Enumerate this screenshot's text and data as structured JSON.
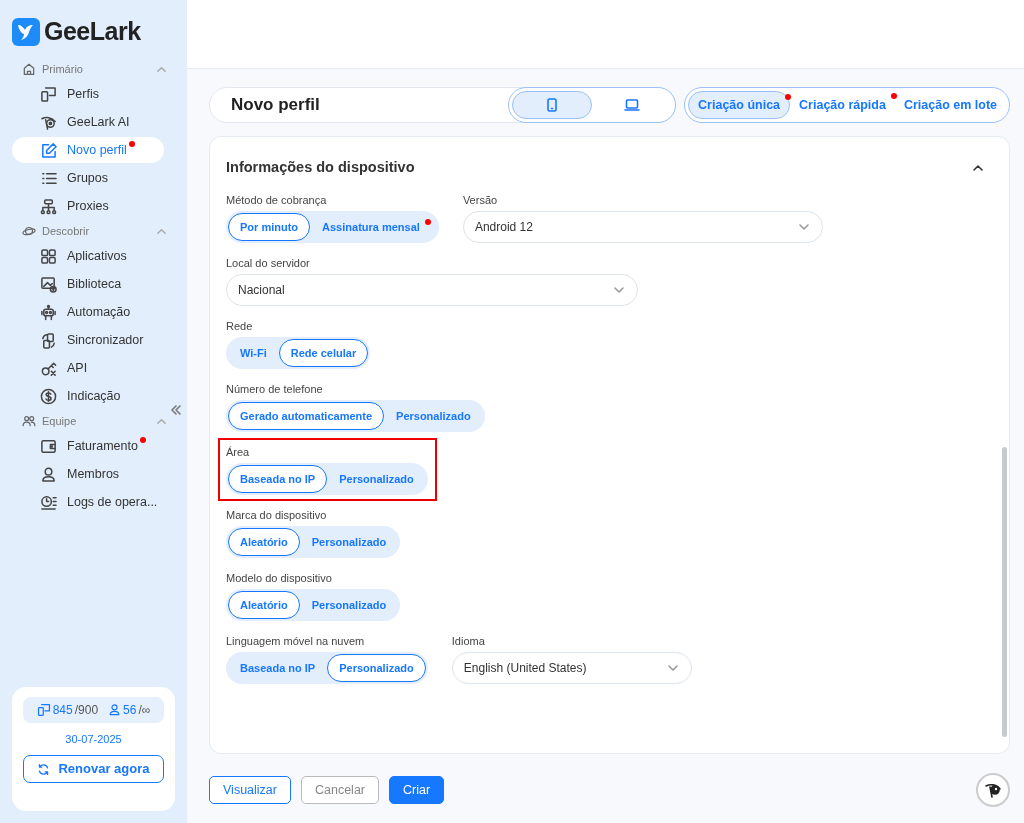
{
  "sidebar": {
    "logo": "GeeLark",
    "groups": [
      {
        "title": "Primário",
        "expanded": true,
        "items": [
          {
            "label": "Perfis",
            "selected": false,
            "dot": false
          },
          {
            "label": "GeeLark AI",
            "selected": false,
            "dot": false
          },
          {
            "label": "Novo perfil",
            "selected": true,
            "dot": true
          },
          {
            "label": "Grupos",
            "selected": false,
            "dot": false
          },
          {
            "label": "Proxies",
            "selected": false,
            "dot": false
          }
        ]
      },
      {
        "title": "Descobrir",
        "expanded": true,
        "items": [
          {
            "label": "Aplicativos",
            "selected": false,
            "dot": false
          },
          {
            "label": "Biblioteca",
            "selected": false,
            "dot": false
          },
          {
            "label": "Automação",
            "selected": false,
            "dot": false
          },
          {
            "label": "Sincronizador",
            "selected": false,
            "dot": false
          },
          {
            "label": "API",
            "selected": false,
            "dot": false
          },
          {
            "label": "Indicação",
            "selected": false,
            "dot": false
          }
        ]
      },
      {
        "title": "Equipe",
        "expanded": true,
        "items": [
          {
            "label": "Faturamento",
            "selected": false,
            "dot": true
          },
          {
            "label": "Membros",
            "selected": false,
            "dot": false
          },
          {
            "label": "Logs de opera...",
            "selected": false,
            "dot": false
          }
        ]
      }
    ],
    "plan": {
      "profiles_used": "845",
      "profiles_total": "/900",
      "members_used": "56",
      "members_total": "/∞",
      "date": "30-07-2025",
      "renew_button": "Renovar agora"
    }
  },
  "header": {
    "title": "Novo perfil",
    "device_tabs": [
      {
        "selected": true
      },
      {
        "selected": false
      }
    ],
    "creation_tabs": [
      {
        "label": "Criação única",
        "selected": true,
        "dot": true
      },
      {
        "label": "Criação rápida",
        "selected": false,
        "dot": true
      },
      {
        "label": "Criação em lote",
        "selected": false,
        "dot": false
      }
    ]
  },
  "form": {
    "title": "Informações do dispositivo",
    "expanded": true,
    "rows": [
      [
        {
          "kind": "segmented",
          "label": "Método de cobrança",
          "highlighted": false,
          "options": [
            {
              "label": "Por minuto",
              "selected": true,
              "dot": false
            },
            {
              "label": "Assinatura mensal",
              "selected": false,
              "dot": true
            }
          ]
        },
        {
          "kind": "select",
          "label": "Versão",
          "highlighted": false,
          "value": "Android 12"
        }
      ],
      [
        {
          "kind": "select",
          "label": "Local do servidor",
          "highlighted": false,
          "value": "Nacional"
        }
      ],
      [
        {
          "kind": "segmented",
          "label": "Rede",
          "highlighted": false,
          "options": [
            {
              "label": "Wi-Fi",
              "selected": false,
              "dot": false
            },
            {
              "label": "Rede celular",
              "selected": true,
              "dot": false
            }
          ]
        }
      ],
      [
        {
          "kind": "segmented",
          "label": "Número de telefone",
          "highlighted": false,
          "options": [
            {
              "label": "Gerado automaticamente",
              "selected": true,
              "dot": false
            },
            {
              "label": "Personalizado",
              "selected": false,
              "dot": false
            }
          ]
        }
      ],
      [
        {
          "kind": "segmented",
          "label": "Área",
          "highlighted": true,
          "options": [
            {
              "label": "Baseada no IP",
              "selected": true,
              "dot": false
            },
            {
              "label": "Personalizado",
              "selected": false,
              "dot": false
            }
          ]
        }
      ],
      [
        {
          "kind": "segmented",
          "label": "Marca do dispositivo",
          "highlighted": false,
          "options": [
            {
              "label": "Aleatório",
              "selected": true,
              "dot": false
            },
            {
              "label": "Personalizado",
              "selected": false,
              "dot": false
            }
          ]
        }
      ],
      [
        {
          "kind": "segmented",
          "label": "Modelo do dispositivo",
          "highlighted": false,
          "options": [
            {
              "label": "Aleatório",
              "selected": true,
              "dot": false
            },
            {
              "label": "Personalizado",
              "selected": false,
              "dot": false
            }
          ]
        }
      ],
      [
        {
          "kind": "segmented",
          "label": "Linguagem móvel na nuvem",
          "highlighted": false,
          "options": [
            {
              "label": "Baseada no IP",
              "selected": false,
              "dot": false
            },
            {
              "label": "Personalizado",
              "selected": true,
              "dot": false
            }
          ]
        },
        {
          "kind": "select",
          "label": "Idioma",
          "highlighted": false,
          "value": "English (United States)"
        }
      ]
    ]
  },
  "footer": {
    "buttons": [
      {
        "label": "Visualizar",
        "kind": "outline"
      },
      {
        "label": "Cancelar",
        "kind": "secondary"
      },
      {
        "label": "Criar",
        "kind": "primary"
      }
    ]
  }
}
